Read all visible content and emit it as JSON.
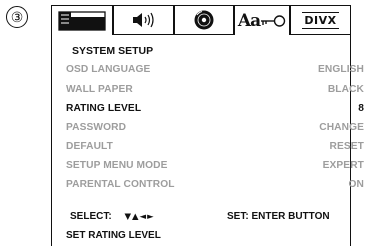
{
  "step_number": "③",
  "tabs": [
    {
      "name": "language-tab",
      "icon": "language-screen-icon"
    },
    {
      "name": "audio-tab",
      "icon": "speaker-icon"
    },
    {
      "name": "disc-tab",
      "icon": "disc-icon"
    },
    {
      "name": "system-setup-tab",
      "icon": "rating-key-icon",
      "text": "Aa",
      "selected": true
    },
    {
      "name": "divx-tab",
      "icon": "divx-icon",
      "text": "DIVX"
    }
  ],
  "menu": {
    "title": "SYSTEM SETUP",
    "items": [
      {
        "label": "OSD LANGUAGE",
        "value": "ENGLISH",
        "highlighted": false
      },
      {
        "label": "WALL PAPER",
        "value": "BLACK",
        "highlighted": false
      },
      {
        "label": "RATING LEVEL",
        "value": "8",
        "highlighted": true
      },
      {
        "label": "PASSWORD",
        "value": "CHANGE",
        "highlighted": false
      },
      {
        "label": "DEFAULT",
        "value": "RESET",
        "highlighted": false
      },
      {
        "label": "SETUP MENU MODE",
        "value": "EXPERT",
        "highlighted": false
      },
      {
        "label": "PARENTAL CONTROL",
        "value": "ON",
        "highlighted": false
      }
    ]
  },
  "footer": {
    "select_label": "SELECT:",
    "select_arrows": "▼▲◄►",
    "set_label": "SET: ENTER BUTTON",
    "hint": "SET RATING LEVEL"
  },
  "colors": {
    "active_text": "#111111",
    "inactive_text": "#9d9d9d",
    "border": "#111111"
  }
}
